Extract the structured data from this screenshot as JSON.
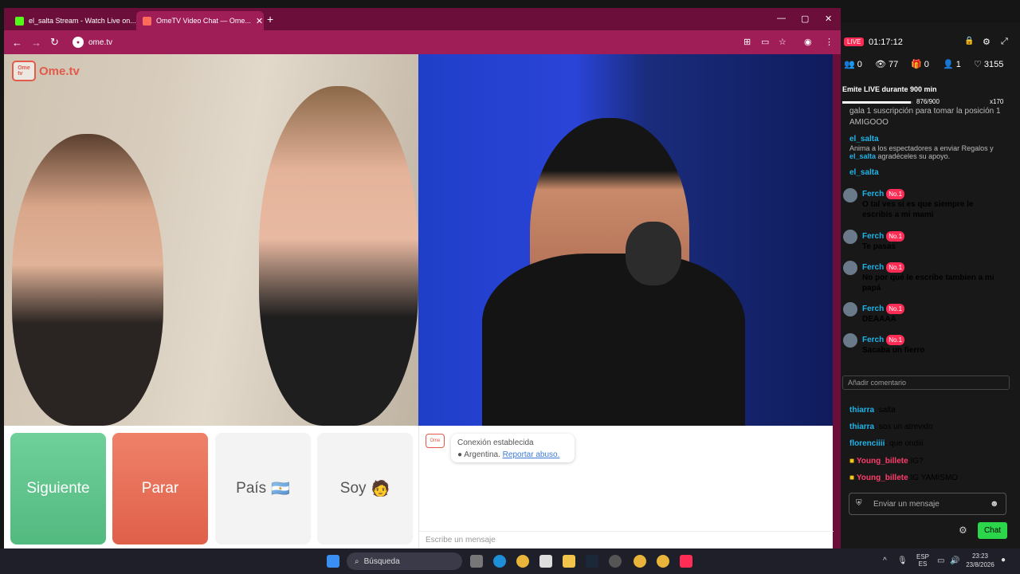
{
  "tabs": [
    {
      "title": "el_salta Stream - Watch Live on..."
    },
    {
      "title": "OmeTV Video Chat — Ome..."
    }
  ],
  "address": {
    "url": "ome.tv"
  },
  "brand": {
    "name": "Ome.tv"
  },
  "controls": {
    "next": "Siguiente",
    "stop": "Parar",
    "country": "País",
    "me": "Soy",
    "country_flag": "🇦🇷",
    "me_emoji": "🧑"
  },
  "chat": {
    "connection": "Conexión establecida",
    "country": "Argentina.",
    "report": "Reportar abuso.",
    "input_placeholder": "Escribe un mensaje"
  },
  "stream": {
    "live_badge": "LIVE",
    "timer": "01:17:12",
    "stats": {
      "viewers_low": "0",
      "viewers": "77",
      "gifts": "0",
      "likes_small": "1",
      "likes": "3155"
    },
    "goal_title": "Emite LIVE durante 900 min",
    "goal_progress": "876/900",
    "goal_mult": "x170",
    "goal_fraction": 0.973,
    "messages": [
      {
        "user": "",
        "text": "gala 1 suscripción para tomar la posición 1"
      },
      {
        "user": "",
        "text": "AMIGOOO"
      },
      {
        "user": "el_salta",
        "text": "",
        "badge": ""
      },
      {
        "user": "",
        "text": "Anima a los espectadores a enviar Regalos y"
      },
      {
        "user": "el_salta",
        "text": "agradéceles su apoyo."
      },
      {
        "user": "el_salta",
        "text": ""
      },
      {
        "user": "Ferch",
        "badge": "No.1",
        "text": "O tal ves si es que siempre le escribís a mi mami"
      },
      {
        "user": "Ferch",
        "badge": "No.1",
        "text": "Te pasas"
      },
      {
        "user": "Ferch",
        "badge": "No.1",
        "text": "No por qué le escribe tambien a mi papá"
      },
      {
        "user": "Ferch",
        "badge": "No.1",
        "text": "DEAAAA"
      },
      {
        "user": "Ferch",
        "badge": "No.1",
        "text": "Sacaba un fierro"
      },
      {
        "user": "thiarra",
        "text": "salta"
      },
      {
        "user": "thiarra",
        "text": "sos un atrevido"
      },
      {
        "user": "florenciiii",
        "text": "que ondiii"
      },
      {
        "user": "Young_billete",
        "text": "IG?"
      },
      {
        "user": "Young_billete",
        "text": "IG YAMISMO"
      }
    ],
    "input_placeholder": "Enviar un mensaje",
    "add_comment": "Añadir comentario",
    "chat_button": "Chat"
  },
  "taskbar": {
    "search": "Búsqueda",
    "lang": "ESP ES",
    "time": "23:23",
    "date": "23/8/2026"
  }
}
